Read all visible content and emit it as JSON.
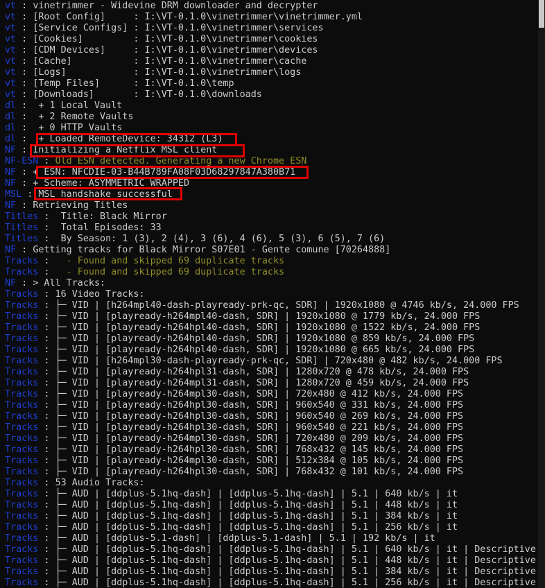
{
  "terminal": {
    "lines": [
      {
        "tag": "vt",
        "msg": "vinetrimmer - Widevine DRM downloader and decrypter",
        "style": "white"
      },
      {
        "tag": "vt",
        "msg": "[Root Config]     : I:\\VT-0.1.0\\vinetrimmer\\vinetrimmer.yml",
        "style": "white"
      },
      {
        "tag": "vt",
        "msg": "[Service Configs] : I:\\VT-0.1.0\\vinetrimmer\\services",
        "style": "white"
      },
      {
        "tag": "vt",
        "msg": "[Cookies]         : I:\\VT-0.1.0\\vinetrimmer\\cookies",
        "style": "white"
      },
      {
        "tag": "vt",
        "msg": "[CDM Devices]     : I:\\VT-0.1.0\\vinetrimmer\\devices",
        "style": "white"
      },
      {
        "tag": "vt",
        "msg": "[Cache]           : I:\\VT-0.1.0\\vinetrimmer\\cache",
        "style": "white"
      },
      {
        "tag": "vt",
        "msg": "[Logs]            : I:\\VT-0.1.0\\vinetrimmer\\logs",
        "style": "white"
      },
      {
        "tag": "vt",
        "msg": "[Temp Files]      : I:\\VT-0.1.0\\temp",
        "style": "white"
      },
      {
        "tag": "vt",
        "msg": "[Downloads]       : I:\\VT-0.1.0\\downloads",
        "style": "white"
      },
      {
        "tag": "dl",
        "msg": " + 1 Local Vault",
        "style": "white"
      },
      {
        "tag": "dl",
        "msg": " + 2 Remote Vaults",
        "style": "white"
      },
      {
        "tag": "dl",
        "msg": " + 0 HTTP Vaults",
        "style": "white"
      },
      {
        "tag": "dl",
        "msg": " + Loaded RemoteDevice: 34312 (L3)",
        "style": "white"
      },
      {
        "tag": "NF",
        "msg": "Initializing a Netflix MSL client",
        "style": "white"
      },
      {
        "tag": "NF-ESN",
        "msg": "Old ESN detected. Generating a new Chrome ESN",
        "style": "yellow"
      },
      {
        "tag": "NF",
        "msg": "+ ESN: NFCDIE-03-B44B789FA08F03D68297847A380B71",
        "style": "white"
      },
      {
        "tag": "NF",
        "msg": "+ Scheme: ASYMMETRIC_WRAPPED",
        "style": "white"
      },
      {
        "tag": "MSL",
        "msg": "MSL handshake successful",
        "style": "white"
      },
      {
        "tag": "NF",
        "msg": "Retrieving Titles",
        "style": "white"
      },
      {
        "tag": "Titles",
        "msg": " Title: Black Mirror",
        "style": "white"
      },
      {
        "tag": "Titles",
        "msg": " Total Episodes: 33",
        "style": "white"
      },
      {
        "tag": "Titles",
        "msg": " By Season: 1 (3), 2 (4), 3 (6), 4 (6), 5 (3), 6 (5), 7 (6)",
        "style": "white"
      },
      {
        "tag": "NF",
        "msg": "Getting tracks for Black Mirror S07E01 - Gente comune [70264888]",
        "style": "white"
      },
      {
        "tag": "Tracks",
        "msg": "  - Found and skipped 69 duplicate tracks",
        "style": "yellow"
      },
      {
        "tag": "Tracks",
        "msg": "  - Found and skipped 69 duplicate tracks",
        "style": "yellow"
      },
      {
        "tag": "NF",
        "msg": "> All Tracks:",
        "style": "white"
      },
      {
        "tag": "Tracks",
        "msg": "16 Video Tracks:",
        "style": "white"
      },
      {
        "tag": "Tracks",
        "msg": "├─ VID | [h264mpl40-dash-playready-prk-qc, SDR] | 1920x1080 @ 4746 kb/s, 24.000 FPS",
        "style": "white"
      },
      {
        "tag": "Tracks",
        "msg": "├─ VID | [playready-h264mpl40-dash, SDR] | 1920x1080 @ 1779 kb/s, 24.000 FPS",
        "style": "white"
      },
      {
        "tag": "Tracks",
        "msg": "├─ VID | [playready-h264hpl40-dash, SDR] | 1920x1080 @ 1522 kb/s, 24.000 FPS",
        "style": "white"
      },
      {
        "tag": "Tracks",
        "msg": "├─ VID | [playready-h264hpl40-dash, SDR] | 1920x1080 @ 859 kb/s, 24.000 FPS",
        "style": "white"
      },
      {
        "tag": "Tracks",
        "msg": "├─ VID | [playready-h264hpl40-dash, SDR] | 1920x1080 @ 665 kb/s, 24.000 FPS",
        "style": "white"
      },
      {
        "tag": "Tracks",
        "msg": "├─ VID | [h264mpl30-dash-playready-prk-qc, SDR] | 720x480 @ 482 kb/s, 24.000 FPS",
        "style": "white"
      },
      {
        "tag": "Tracks",
        "msg": "├─ VID | [playready-h264hpl31-dash, SDR] | 1280x720 @ 478 kb/s, 24.000 FPS",
        "style": "white"
      },
      {
        "tag": "Tracks",
        "msg": "├─ VID | [playready-h264mpl31-dash, SDR] | 1280x720 @ 459 kb/s, 24.000 FPS",
        "style": "white"
      },
      {
        "tag": "Tracks",
        "msg": "├─ VID | [playready-h264mpl30-dash, SDR] | 720x480 @ 412 kb/s, 24.000 FPS",
        "style": "white"
      },
      {
        "tag": "Tracks",
        "msg": "├─ VID | [playready-h264hpl30-dash, SDR] | 960x540 @ 331 kb/s, 24.000 FPS",
        "style": "white"
      },
      {
        "tag": "Tracks",
        "msg": "├─ VID | [playready-h264hpl30-dash, SDR] | 960x540 @ 269 kb/s, 24.000 FPS",
        "style": "white"
      },
      {
        "tag": "Tracks",
        "msg": "├─ VID | [playready-h264hpl30-dash, SDR] | 960x540 @ 221 kb/s, 24.000 FPS",
        "style": "white"
      },
      {
        "tag": "Tracks",
        "msg": "├─ VID | [playready-h264mpl30-dash, SDR] | 720x480 @ 209 kb/s, 24.000 FPS",
        "style": "white"
      },
      {
        "tag": "Tracks",
        "msg": "├─ VID | [playready-h264hpl30-dash, SDR] | 768x432 @ 145 kb/s, 24.000 FPS",
        "style": "white"
      },
      {
        "tag": "Tracks",
        "msg": "├─ VID | [playready-h264mpl30-dash, SDR] | 512x384 @ 105 kb/s, 24.000 FPS",
        "style": "white"
      },
      {
        "tag": "Tracks",
        "msg": "├─ VID | [playready-h264hpl30-dash, SDR] | 768x432 @ 101 kb/s, 24.000 FPS",
        "style": "white"
      },
      {
        "tag": "Tracks",
        "msg": "53 Audio Tracks:",
        "style": "white"
      },
      {
        "tag": "Tracks",
        "msg": "├─ AUD | [ddplus-5.1hq-dash] | [ddplus-5.1hq-dash] | 5.1 | 640 kb/s | it",
        "style": "white"
      },
      {
        "tag": "Tracks",
        "msg": "├─ AUD | [ddplus-5.1hq-dash] | [ddplus-5.1hq-dash] | 5.1 | 448 kb/s | it",
        "style": "white"
      },
      {
        "tag": "Tracks",
        "msg": "├─ AUD | [ddplus-5.1hq-dash] | [ddplus-5.1hq-dash] | 5.1 | 384 kb/s | it",
        "style": "white"
      },
      {
        "tag": "Tracks",
        "msg": "├─ AUD | [ddplus-5.1hq-dash] | [ddplus-5.1hq-dash] | 5.1 | 256 kb/s | it",
        "style": "white"
      },
      {
        "tag": "Tracks",
        "msg": "├─ AUD | [ddplus-5.1-dash] | [ddplus-5.1-dash] | 5.1 | 192 kb/s | it",
        "style": "white"
      },
      {
        "tag": "Tracks",
        "msg": "├─ AUD | [ddplus-5.1hq-dash] | [ddplus-5.1hq-dash] | 5.1 | 640 kb/s | it | Descriptive",
        "style": "white"
      },
      {
        "tag": "Tracks",
        "msg": "├─ AUD | [ddplus-5.1hq-dash] | [ddplus-5.1hq-dash] | 5.1 | 448 kb/s | it | Descriptive",
        "style": "white"
      },
      {
        "tag": "Tracks",
        "msg": "├─ AUD | [ddplus-5.1hq-dash] | [ddplus-5.1hq-dash] | 5.1 | 384 kb/s | it | Descriptive",
        "style": "white"
      },
      {
        "tag": "Tracks",
        "msg": "├─ AUD | [ddplus-5.1hq-dash] | [ddplus-5.1hq-dash] | 5.1 | 256 kb/s | it | Descriptive",
        "style": "white"
      }
    ]
  },
  "colors": {
    "background": "#0c0c0c",
    "text": "#cccccc",
    "tag": "#1e3fd4",
    "warning": "#8f8e2a",
    "highlight_box": "#e00000"
  }
}
